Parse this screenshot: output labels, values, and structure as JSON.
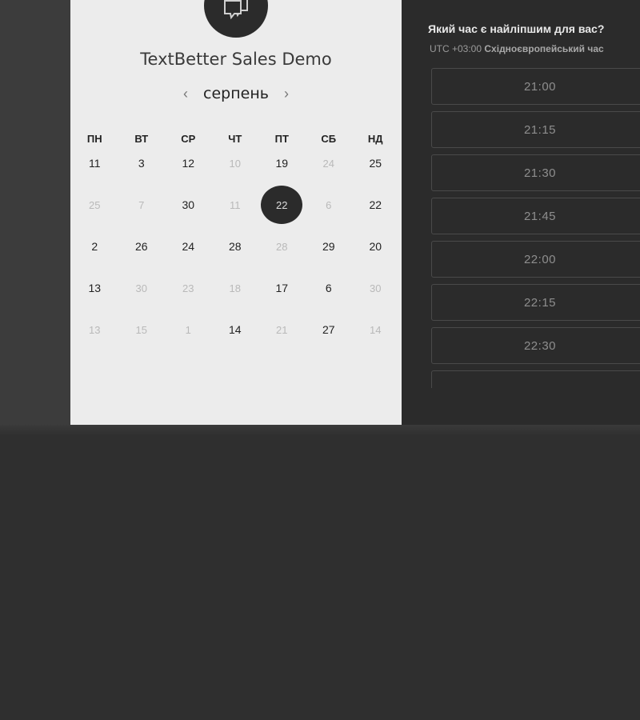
{
  "event": {
    "title": "TextBetter Sales Demo"
  },
  "calendar": {
    "month": "серпень",
    "prev_arrow": "‹",
    "next_arrow": "›",
    "weekdays": [
      "ПН",
      "ВТ",
      "СР",
      "ЧТ",
      "ПТ",
      "СБ",
      "НД"
    ],
    "weeks": [
      [
        {
          "label": "11",
          "state": "active"
        },
        {
          "label": "3",
          "state": "active"
        },
        {
          "label": "12",
          "state": "active"
        },
        {
          "label": "10",
          "state": "muted"
        },
        {
          "label": "19",
          "state": "active"
        },
        {
          "label": "24",
          "state": "muted"
        },
        {
          "label": "25",
          "state": "active"
        }
      ],
      [
        {
          "label": "25",
          "state": "muted"
        },
        {
          "label": "7",
          "state": "muted"
        },
        {
          "label": "30",
          "state": "active"
        },
        {
          "label": "11",
          "state": "muted"
        },
        {
          "label": "22",
          "state": "selected"
        },
        {
          "label": "6",
          "state": "muted"
        },
        {
          "label": "22",
          "state": "active"
        }
      ],
      [
        {
          "label": "2",
          "state": "active"
        },
        {
          "label": "26",
          "state": "active"
        },
        {
          "label": "24",
          "state": "active"
        },
        {
          "label": "28",
          "state": "active"
        },
        {
          "label": "28",
          "state": "muted"
        },
        {
          "label": "29",
          "state": "active"
        },
        {
          "label": "20",
          "state": "active"
        }
      ],
      [
        {
          "label": "13",
          "state": "active"
        },
        {
          "label": "30",
          "state": "muted"
        },
        {
          "label": "23",
          "state": "muted"
        },
        {
          "label": "18",
          "state": "muted"
        },
        {
          "label": "17",
          "state": "active"
        },
        {
          "label": "6",
          "state": "active"
        },
        {
          "label": "30",
          "state": "muted"
        }
      ],
      [
        {
          "label": "13",
          "state": "muted"
        },
        {
          "label": "15",
          "state": "muted"
        },
        {
          "label": "1",
          "state": "muted"
        },
        {
          "label": "14",
          "state": "active"
        },
        {
          "label": "21",
          "state": "muted"
        },
        {
          "label": "27",
          "state": "active"
        },
        {
          "label": "14",
          "state": "muted"
        }
      ]
    ]
  },
  "time_picker": {
    "question": "Який час є найліпшим для вас?",
    "timezone_offset": "UTC +03:00",
    "timezone_name": "Східноєвропейський час",
    "slots": [
      "21:00",
      "21:15",
      "21:30",
      "21:45",
      "22:00",
      "22:15",
      "22:30",
      ""
    ]
  },
  "icons": {
    "logo": "chat-bubbles-icon"
  },
  "colors": {
    "page_bg": "#2f2f2f",
    "card_bg": "#ececec",
    "panel_bg": "#2b2b2b",
    "selected_day": "#2b2b2b"
  }
}
